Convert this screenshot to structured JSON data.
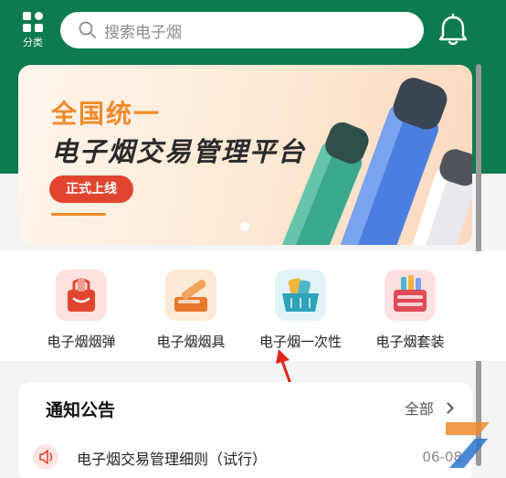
{
  "header": {
    "category_label": "分类",
    "search_placeholder": "搜索电子烟"
  },
  "banner": {
    "line1": "全国统一",
    "line2": "电子烟交易管理平台",
    "button": "正式上线"
  },
  "categories": [
    {
      "label": "电子烟烟弹",
      "icon": "cartridge-bag-icon"
    },
    {
      "label": "电子烟烟具",
      "icon": "device-box-icon"
    },
    {
      "label": "电子烟一次性",
      "icon": "disposable-basket-icon"
    },
    {
      "label": "电子烟套装",
      "icon": "kit-box-icon"
    }
  ],
  "notice": {
    "title": "通知公告",
    "more": "全部",
    "items": [
      {
        "text": "电子烟交易管理细则（试行）",
        "date": "06-08"
      }
    ]
  },
  "colors": {
    "brand": "#0e7a4f",
    "accent": "#f0892a",
    "badge": "#e2452f"
  }
}
